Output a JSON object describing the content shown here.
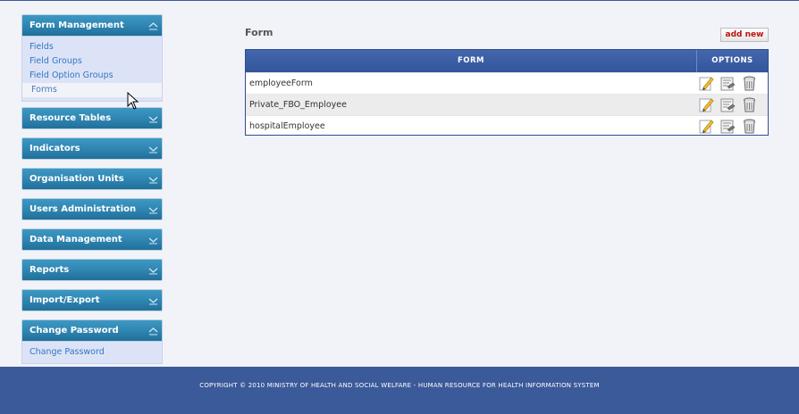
{
  "sidebar": {
    "menus": [
      {
        "title": "Form Management",
        "items": [
          "Fields",
          "Field Groups",
          "Field Option Groups",
          "Forms"
        ]
      },
      {
        "title": "Resource Tables"
      },
      {
        "title": "Indicators"
      },
      {
        "title": "Organisation Units"
      },
      {
        "title": "Users Administration"
      },
      {
        "title": "Data Management"
      },
      {
        "title": "Reports"
      },
      {
        "title": "Import/Export"
      },
      {
        "title": "Change Password",
        "items": [
          "Change Password"
        ]
      }
    ]
  },
  "main": {
    "title": "Form",
    "add_new_label": "add new",
    "table": {
      "columns": [
        "FORM",
        "OPTIONS"
      ],
      "rows": [
        "employeeForm",
        "Private_FBO_Employee",
        "hospitalEmployee"
      ]
    }
  },
  "footer": {
    "text": "COPYRIGHT © 2010 MINISTRY OF HEALTH AND SOCIAL WELFARE - HUMAN RESOURCE FOR HEALTH INFORMATION SYSTEM"
  },
  "colors": {
    "menu_header": "#2f86b2",
    "table_header": "#3b5a9a",
    "footer": "#3b5a9a",
    "link": "#2f77c3"
  },
  "icons": {
    "menu_open": "chevron-up-icon",
    "menu_closed": "chevron-down-icon",
    "row_options": [
      "edit-icon",
      "section-edit-icon",
      "delete-icon"
    ]
  }
}
